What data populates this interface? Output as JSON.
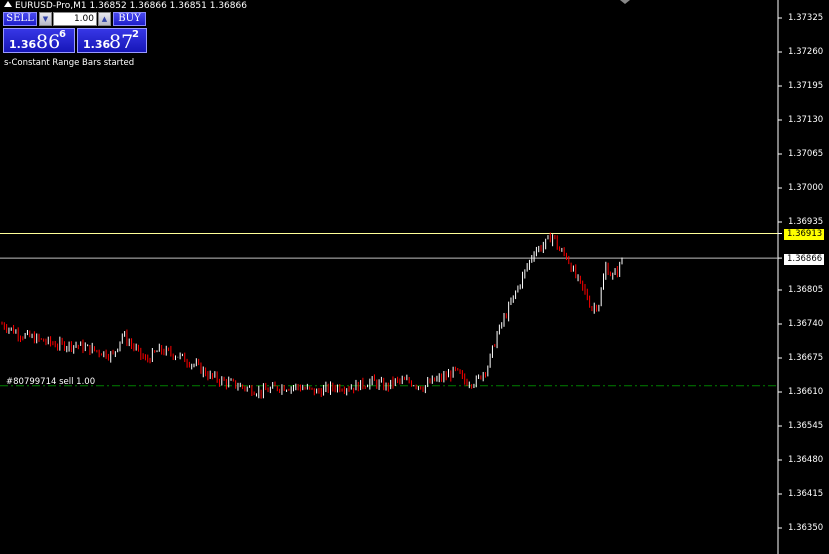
{
  "window": {
    "symbol_line": "EURUSD-Pro,M1  1.36852 1.36866 1.36851 1.36866"
  },
  "trade_panel": {
    "sell_label": "SELL",
    "buy_label": "BUY",
    "lot_value": "1.00",
    "sell_price_prefix": "1.36",
    "sell_price_big": "86",
    "sell_price_sup": "6",
    "buy_price_prefix": "1.36",
    "buy_price_big": "87",
    "buy_price_sup": "2"
  },
  "status_text": "s-Constant Range Bars started",
  "order_label": "#80799714 sell 1.00",
  "price_axis": {
    "ticks": [
      "1.37325",
      "1.37260",
      "1.37195",
      "1.37130",
      "1.37065",
      "1.37000",
      "1.36935",
      "1.36805",
      "1.36740",
      "1.36675",
      "1.36610",
      "1.36545",
      "1.36480",
      "1.36415",
      "1.36350"
    ],
    "ask_tag": "1.36913",
    "bid_tag": "1.36866"
  },
  "colors": {
    "background": "#000000",
    "bull_bar": "#ffffff",
    "bear_bar": "#ff0000",
    "ask_line": "#ffff99",
    "bid_line": "#c0c0c0",
    "order_line": "#008000",
    "ask_tag_bg": "#ffff00",
    "bid_tag_bg": "#ffffff"
  },
  "chart_data": {
    "type": "candlestick",
    "symbol": "EURUSD-Pro",
    "timeframe": "M1",
    "ask_price": 1.36913,
    "bid_price": 1.36866,
    "order_price": 1.36622,
    "ylim": [
      1.3631,
      1.374
    ],
    "bar_count": 200,
    "anchors": [
      [
        0,
        1.3674
      ],
      [
        8,
        1.3672
      ],
      [
        16,
        1.3671
      ],
      [
        24,
        1.367
      ],
      [
        32,
        1.367
      ],
      [
        40,
        1.3669
      ],
      [
        48,
        1.3668
      ],
      [
        52,
        1.3672
      ],
      [
        56,
        1.367
      ],
      [
        62,
        1.3667
      ],
      [
        68,
        1.3669
      ],
      [
        76,
        1.3668
      ],
      [
        84,
        1.3666
      ],
      [
        90,
        1.3664
      ],
      [
        96,
        1.3663
      ],
      [
        104,
        1.3662
      ],
      [
        112,
        1.3661
      ],
      [
        120,
        1.3662
      ],
      [
        128,
        1.3662
      ],
      [
        136,
        1.3661
      ],
      [
        144,
        1.3662
      ],
      [
        152,
        1.3662
      ],
      [
        160,
        1.3663
      ],
      [
        166,
        1.3662
      ],
      [
        170,
        1.3663
      ],
      [
        176,
        1.3663
      ],
      [
        182,
        1.3662
      ],
      [
        186,
        1.3663
      ],
      [
        192,
        1.3664
      ],
      [
        196,
        1.3665
      ],
      [
        200,
        1.3663
      ],
      [
        205,
        1.3663
      ],
      [
        210,
        1.3666
      ],
      [
        214,
        1.3672
      ],
      [
        218,
        1.3676
      ],
      [
        222,
        1.368
      ],
      [
        226,
        1.3684
      ],
      [
        230,
        1.3688
      ],
      [
        234,
        1.3689
      ],
      [
        238,
        1.3691
      ],
      [
        241,
        1.3688
      ],
      [
        244,
        1.3687
      ],
      [
        248,
        1.3683
      ],
      [
        252,
        1.368
      ],
      [
        255,
        1.3677
      ],
      [
        258,
        1.3678
      ],
      [
        261,
        1.3685
      ],
      [
        264,
        1.3683
      ],
      [
        267,
        1.3685
      ],
      [
        268,
        1.36866
      ]
    ]
  }
}
